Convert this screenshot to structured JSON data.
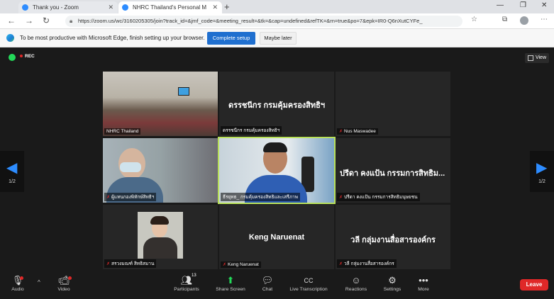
{
  "browser": {
    "tabs": [
      {
        "label": "Thank you - Zoom"
      },
      {
        "label": "NHRC Thailand's Personal M"
      }
    ],
    "url": "https://zoom.us/wc/3160205305/join?track_id=&jmf_code=&meeting_result=&tk=&cap=undefined&refTK=&rn=true&po=7&epk=IR0-Q6nXutCYFe_",
    "infobar": {
      "message": "To be most productive with Microsoft Edge, finish setting up your browser.",
      "primary_button": "Complete setup",
      "secondary_button": "Maybe later"
    }
  },
  "meeting": {
    "rec_label": "REC",
    "view_label": "View",
    "page_indicator": "1/2",
    "participants": [
      {
        "id": "p1",
        "name": "NHRC Thailand",
        "type": "video"
      },
      {
        "id": "p2",
        "name": "ดรรชนีกร กรมคุ้มครองสิทธิฯ",
        "display": "ดรรชนีกร กรมคุ้มครองสิทธิฯ",
        "type": "name"
      },
      {
        "id": "p3",
        "name": "Nus Maswadee",
        "type": "blank",
        "muted": true
      },
      {
        "id": "p4",
        "name": "ผู้แทนกองพิทักษ์สิทธิฯ",
        "type": "video",
        "muted": true
      },
      {
        "id": "p5",
        "name": "ธีรยุทธ_ กรมคุ้มครองสิทธิและเสรีภาพ",
        "type": "video",
        "active_speaker": true
      },
      {
        "id": "p6",
        "name": "ปรีดา คงแป้น กรรมการสิทธิมนุษยชน",
        "display": "ปรีดา คงแป้น กรรมการสิทธิม...",
        "type": "name",
        "muted": true
      },
      {
        "id": "p7",
        "name": "สรวงมณฑ์ สิทธิสมาน",
        "type": "video",
        "muted": true
      },
      {
        "id": "p8",
        "name": "Keng Naruenat",
        "display": "Keng Naruenat",
        "type": "name",
        "muted": true
      },
      {
        "id": "p9",
        "name": "วลี กลุ่มงานสื่อสารองค์กร",
        "display": "วลี กลุ่มงานสื่อสารองค์กร",
        "type": "name",
        "muted": true
      }
    ]
  },
  "toolbar": {
    "audio": "Audio",
    "video": "Video",
    "participants": "Participants",
    "participant_count": "13",
    "share": "Share Screen",
    "chat": "Chat",
    "transcription": "Live Transcription",
    "reactions": "Reactions",
    "settings": "Settings",
    "more": "More",
    "leave": "Leave"
  },
  "icons": [
    "shield-icon",
    "record-icon",
    "grid-icon",
    "chevron-left-icon",
    "chevron-right-icon",
    "microphone-icon",
    "camera-icon",
    "people-icon",
    "share-screen-icon",
    "chat-icon",
    "cc-icon",
    "reaction-icon",
    "gear-icon",
    "ellipsis-icon"
  ],
  "colors": {
    "accent": "#2d8cff",
    "leave": "#e02828",
    "share": "#23d959",
    "speaker_outline": "#b8e05b"
  }
}
